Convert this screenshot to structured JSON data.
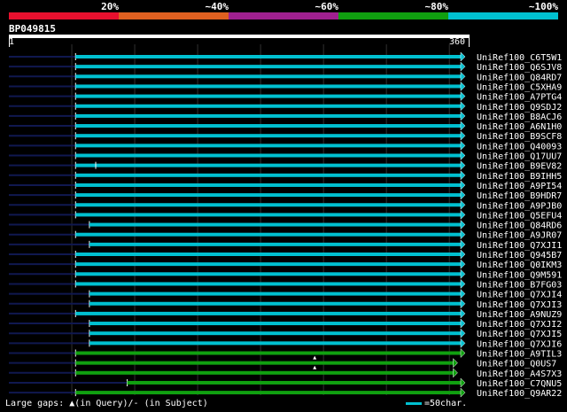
{
  "legend": {
    "labels": [
      "20%",
      "~40%",
      "~60%",
      "~80%",
      "~100%"
    ],
    "colors": [
      "#e8102e",
      "#e06020",
      "#a02090",
      "#10a010",
      "#00c0d0"
    ]
  },
  "query": {
    "id": "BP049815",
    "start": "1",
    "end": "360"
  },
  "hits": [
    {
      "name": "UniRef100_C6T5W1",
      "color": "#00c0d0",
      "start": 54,
      "end": 360
    },
    {
      "name": "UniRef100_Q6SJV8",
      "color": "#00c0d0",
      "start": 54,
      "end": 360
    },
    {
      "name": "UniRef100_Q84RD7",
      "color": "#00c0d0",
      "start": 54,
      "end": 360
    },
    {
      "name": "UniRef100_C5XHA9",
      "color": "#00c0d0",
      "start": 54,
      "end": 360
    },
    {
      "name": "UniRef100_A7PTG4",
      "color": "#00c0d0",
      "start": 54,
      "end": 360
    },
    {
      "name": "UniRef100_Q9SDJ2",
      "color": "#00c0d0",
      "start": 54,
      "end": 360
    },
    {
      "name": "UniRef100_B8ACJ6",
      "color": "#00c0d0",
      "start": 54,
      "end": 360
    },
    {
      "name": "UniRef100_A6N1H0",
      "color": "#00c0d0",
      "start": 54,
      "end": 360
    },
    {
      "name": "UniRef100_B9SCF8",
      "color": "#00c0d0",
      "start": 54,
      "end": 360
    },
    {
      "name": "UniRef100_Q40093",
      "color": "#00c0d0",
      "start": 54,
      "end": 360
    },
    {
      "name": "UniRef100_Q17UU7",
      "color": "#00c0d0",
      "start": 54,
      "end": 360
    },
    {
      "name": "UniRef100_B9EV82",
      "color": "#00c0d0",
      "start": 54,
      "end": 360,
      "gap": 70
    },
    {
      "name": "UniRef100_B9IHH5",
      "color": "#00c0d0",
      "start": 54,
      "end": 360
    },
    {
      "name": "UniRef100_A9PI54",
      "color": "#00c0d0",
      "start": 54,
      "end": 360
    },
    {
      "name": "UniRef100_B9HDR7",
      "color": "#00c0d0",
      "start": 54,
      "end": 360
    },
    {
      "name": "UniRef100_A9PJB0",
      "color": "#00c0d0",
      "start": 54,
      "end": 360
    },
    {
      "name": "UniRef100_Q5EFU4",
      "color": "#00c0d0",
      "start": 54,
      "end": 360
    },
    {
      "name": "UniRef100_Q84RD6",
      "color": "#00c0d0",
      "start": 65,
      "end": 360
    },
    {
      "name": "UniRef100_A9JR07",
      "color": "#00c0d0",
      "start": 54,
      "end": 360
    },
    {
      "name": "UniRef100_Q7XJI1",
      "color": "#00c0d0",
      "start": 65,
      "end": 360
    },
    {
      "name": "UniRef100_Q945B7",
      "color": "#00c0d0",
      "start": 54,
      "end": 360
    },
    {
      "name": "UniRef100_Q0IKM3",
      "color": "#00c0d0",
      "start": 54,
      "end": 360
    },
    {
      "name": "UniRef100_Q9M591",
      "color": "#00c0d0",
      "start": 54,
      "end": 360
    },
    {
      "name": "UniRef100_B7FG03",
      "color": "#00c0d0",
      "start": 54,
      "end": 360
    },
    {
      "name": "UniRef100_Q7XJI4",
      "color": "#00c0d0",
      "start": 65,
      "end": 360
    },
    {
      "name": "UniRef100_Q7XJI3",
      "color": "#00c0d0",
      "start": 65,
      "end": 360
    },
    {
      "name": "UniRef100_A9NUZ9",
      "color": "#00c0d0",
      "start": 54,
      "end": 360
    },
    {
      "name": "UniRef100_Q7XJI2",
      "color": "#00c0d0",
      "start": 65,
      "end": 360
    },
    {
      "name": "UniRef100_Q7XJI5",
      "color": "#00c0d0",
      "start": 65,
      "end": 360
    },
    {
      "name": "UniRef100_Q7XJI6",
      "color": "#00c0d0",
      "start": 65,
      "end": 360
    },
    {
      "name": "UniRef100_A9TIL3",
      "color": "#10a010",
      "start": 54,
      "end": 360
    },
    {
      "name": "UniRef100_Q0US7",
      "color": "#10a010",
      "start": 54,
      "end": 354,
      "gap_query": 244
    },
    {
      "name": "UniRef100_A4S7X3",
      "color": "#10a010",
      "start": 54,
      "end": 354,
      "gap_query": 244
    },
    {
      "name": "UniRef100_C7QNU5",
      "color": "#10a010",
      "start": 95,
      "end": 360
    },
    {
      "name": "UniRef100_Q9AR22",
      "color": "#10a010",
      "start": 54,
      "end": 360
    }
  ],
  "footer": {
    "gaps_label": "Large gaps:",
    "gap_query_label": "(in Query)/",
    "gap_subject_label": "- (in Subject)",
    "scale_label": "=50char."
  }
}
